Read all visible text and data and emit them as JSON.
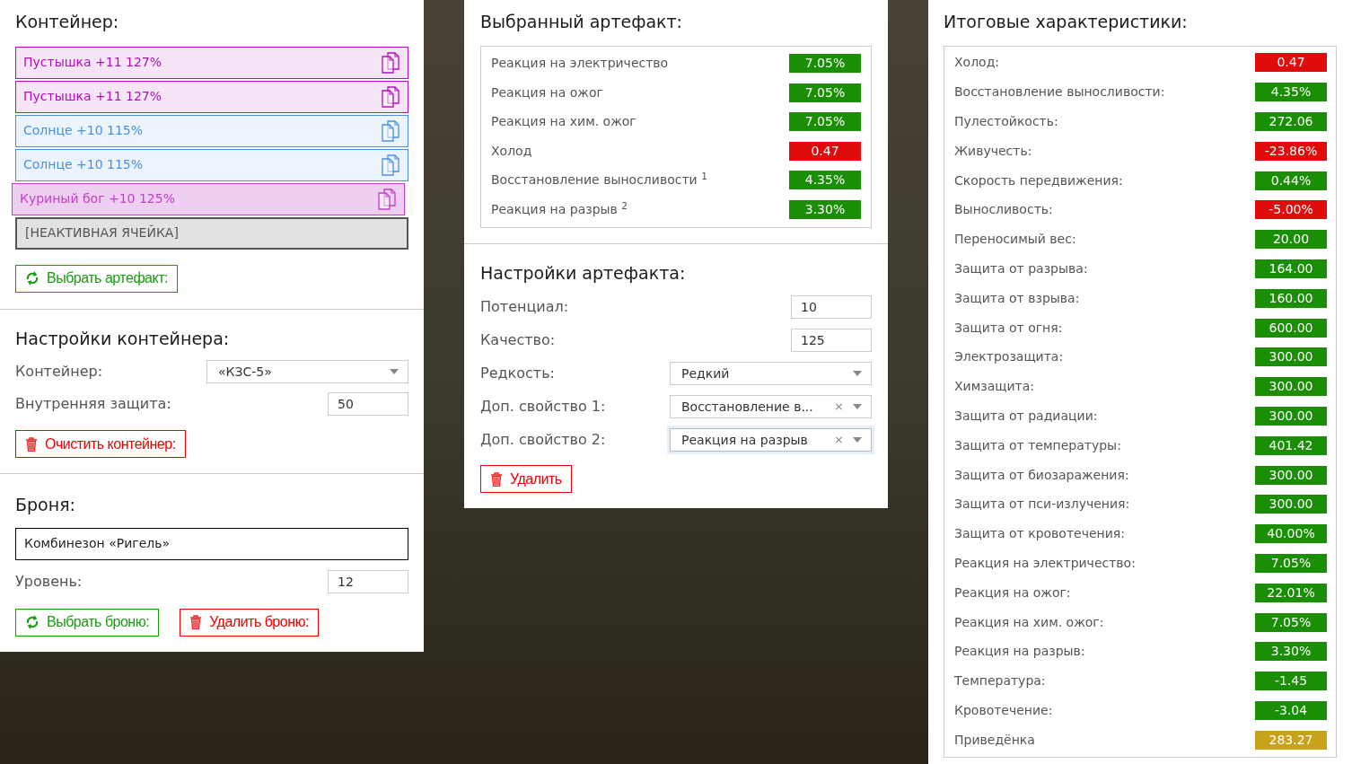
{
  "container": {
    "title": "Контейнер:",
    "slots": [
      {
        "kind": "artifact",
        "label": "Пустышка +11 127%",
        "color": "#b010b8",
        "selected": false
      },
      {
        "kind": "artifact",
        "label": "Пустышка +11 127%",
        "color": "#b010b8",
        "selected": false
      },
      {
        "kind": "artifact",
        "label": "Солнце +10 115%",
        "color": "#4a90e2",
        "selected": false
      },
      {
        "kind": "artifact",
        "label": "Солнце +10 115%",
        "color": "#4a90e2",
        "selected": false
      },
      {
        "kind": "artifact",
        "label": "Куриный бог +10 125%",
        "color": "#c040c8",
        "selected": true
      },
      {
        "kind": "inactive",
        "label": "[НЕАКТИВНАЯ ЯЧЕЙКА]",
        "color": "#555555"
      }
    ],
    "pick_button": "Выбрать артефакт:"
  },
  "container_settings": {
    "title": "Настройки контейнера:",
    "fields": [
      {
        "kind": "select",
        "label": "Контейнер:",
        "value": "«КЗС-5»",
        "focused": false
      },
      {
        "kind": "number",
        "label": "Внутренняя защита:",
        "value": "50"
      }
    ],
    "clear_button": "Очистить контейнер:"
  },
  "armor": {
    "title": "Броня:",
    "name": "Комбинезон «Ригель»",
    "fields": [
      {
        "kind": "number",
        "label": "Уровень:",
        "value": "12"
      }
    ],
    "pick_button": "Выбрать броню:",
    "delete_button": "Удалить броню:"
  },
  "selected_artifact": {
    "title": "Выбранный артефакт:",
    "rows": [
      {
        "label": "Реакция на электричество",
        "value": "7.05%",
        "color": "#1a8f06"
      },
      {
        "label": "Реакция на ожог",
        "value": "7.05%",
        "color": "#1a8f06"
      },
      {
        "label": "Реакция на хим. ожог",
        "value": "7.05%",
        "color": "#1a8f06"
      },
      {
        "label": "Холод",
        "value": "0.47",
        "color": "#e00b0b"
      },
      {
        "label": "Восстановление выносливости $^{1}$",
        "value": "4.35%",
        "color": "#1a8f06"
      },
      {
        "label": "Реакция на разрыв $^{2}$",
        "value": "3.30%",
        "color": "#1a8f06"
      }
    ]
  },
  "artifact_settings": {
    "title": "Настройки артефакта:",
    "fields": [
      {
        "kind": "number",
        "label": "Потенциал:",
        "value": "10"
      },
      {
        "kind": "number",
        "label": "Качество:",
        "value": "125"
      },
      {
        "kind": "select",
        "label": "Редкость:",
        "value": "Редкий",
        "focused": false
      },
      {
        "kind": "select",
        "label": "Доп. свойство 1:",
        "value": "Восстановление в...",
        "clear_icon": "×",
        "focused": false
      },
      {
        "kind": "select",
        "label": "Доп. свойство 2:",
        "value": "Реакция на разрыв",
        "clear_icon": "×",
        "focused": true
      }
    ],
    "delete_button": "Удалить"
  },
  "totals": {
    "title": "Итоговые характеристики:",
    "rows": [
      {
        "label": "Холод:",
        "value": "0.47",
        "color": "#e00b0b"
      },
      {
        "label": "Восстановление выносливости:",
        "value": "4.35%",
        "color": "#1a8f06"
      },
      {
        "label": "Пулестойкость:",
        "value": "272.06",
        "color": "#1a8f06"
      },
      {
        "label": "Живучесть:",
        "value": "-23.86%",
        "color": "#e00b0b"
      },
      {
        "label": "Скорость передвижения:",
        "value": "0.44%",
        "color": "#1a8f06"
      },
      {
        "label": "Выносливость:",
        "value": "-5.00%",
        "color": "#e00b0b"
      },
      {
        "label": "Переносимый вес:",
        "value": "20.00",
        "color": "#1a8f06"
      },
      {
        "label": "Защита от разрыва:",
        "value": "164.00",
        "color": "#1a8f06"
      },
      {
        "label": "Защита от взрыва:",
        "value": "160.00",
        "color": "#1a8f06"
      },
      {
        "label": "Защита от огня:",
        "value": "600.00",
        "color": "#1a8f06"
      },
      {
        "label": "Электрозащита:",
        "value": "300.00",
        "color": "#1a8f06"
      },
      {
        "label": "Химзащита:",
        "value": "300.00",
        "color": "#1a8f06"
      },
      {
        "label": "Защита от радиации:",
        "value": "300.00",
        "color": "#1a8f06"
      },
      {
        "label": "Защита от температуры:",
        "value": "401.42",
        "color": "#1a8f06"
      },
      {
        "label": "Защита от биозаражения:",
        "value": "300.00",
        "color": "#1a8f06"
      },
      {
        "label": "Защита от пси-излучения:",
        "value": "300.00",
        "color": "#1a8f06"
      },
      {
        "label": "Защита от кровотечения:",
        "value": "40.00%",
        "color": "#1a8f06"
      },
      {
        "label": "Реакция на электричество:",
        "value": "7.05%",
        "color": "#1a8f06"
      },
      {
        "label": "Реакция на ожог:",
        "value": "22.01%",
        "color": "#1a8f06"
      },
      {
        "label": "Реакция на хим. ожог:",
        "value": "7.05%",
        "color": "#1a8f06"
      },
      {
        "label": "Реакция на разрыв:",
        "value": "3.30%",
        "color": "#1a8f06"
      },
      {
        "label": "Температура:",
        "value": "-1.45",
        "color": "#1a8f06"
      },
      {
        "label": "Кровотечение:",
        "value": "-3.04",
        "color": "#1a8f06"
      },
      {
        "label": "Приведёнка",
        "value": "283.27",
        "color": "#c8a21a"
      }
    ]
  }
}
